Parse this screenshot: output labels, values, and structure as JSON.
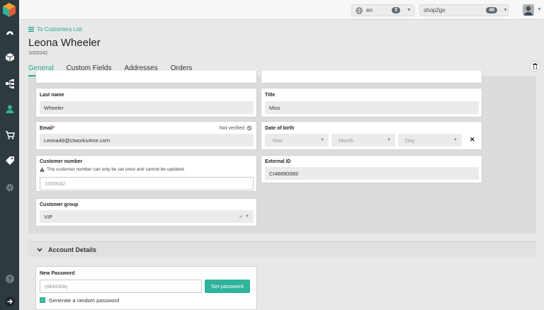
{
  "colors": {
    "accent": "#28a891",
    "sidebar": "#2d3a40"
  },
  "sidebar": {
    "items": [
      {
        "icon": "dashboard-icon"
      },
      {
        "icon": "box-icon"
      },
      {
        "icon": "hierarchy-icon"
      },
      {
        "icon": "user-icon"
      },
      {
        "icon": "cart-icon"
      },
      {
        "icon": "tag-icon"
      },
      {
        "icon": "gear-icon"
      },
      {
        "icon": "help-icon"
      },
      {
        "icon": "arrow-right-icon"
      }
    ]
  },
  "topbar": {
    "language": "en",
    "language_count": "3",
    "shop": "shop2go",
    "shop_count": "46"
  },
  "header": {
    "back_link": "To Customers List",
    "title": "Leona Wheeler",
    "customer_id": "1000042",
    "tabs": [
      "General",
      "Custom Fields",
      "Addresses",
      "Orders"
    ]
  },
  "form": {
    "last_name_label": "Last name",
    "last_name": "Wheeler",
    "title_label": "Title",
    "title": "Miss",
    "email_label": "Email",
    "email_required": "*",
    "email_status": "Not verified",
    "email": "Leona48@ctworks4me.com",
    "dob_label": "Date of birth",
    "dob_year": "Year",
    "dob_month": "Month",
    "dob_day": "Day",
    "customer_number_label": "Customer number",
    "customer_number_note": "The customer number can only be set once and cannot be updated.",
    "customer_number_placeholder": "1000042",
    "external_id_label": "External ID",
    "external_id": "CI48890089",
    "customer_group_label": "Customer group",
    "customer_group": "VIP"
  },
  "account": {
    "section_title": "Account Details",
    "new_password_label": "New Password",
    "password_placeholder": "y8kk04dq",
    "set_password_button": "Set password",
    "random_password_label": "Generate a random password",
    "random_password_checked": true
  }
}
